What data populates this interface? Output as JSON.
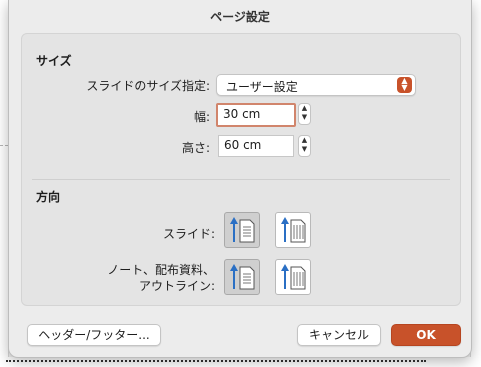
{
  "dialog": {
    "title": "ページ設定"
  },
  "size_section": {
    "heading": "サイズ",
    "slide_size_label": "スライドのサイズ指定:",
    "slide_size_value": "ユーザー設定",
    "width_label": "幅:",
    "width_value": "30 cm",
    "height_label": "高さ:",
    "height_value": "60 cm"
  },
  "orientation_section": {
    "heading": "方向",
    "slides_label": "スライド:",
    "notes_label_line1": "ノート、配布資料、",
    "notes_label_line2": "アウトライン:",
    "slides_selected": "portrait",
    "notes_selected": "portrait"
  },
  "buttons": {
    "header_footer": "ヘッダー/フッター...",
    "cancel": "キャンセル",
    "ok": "OK"
  },
  "colors": {
    "accent": "#c8522a",
    "focus_ring": "#d1856c",
    "arrow_blue": "#2a6fc4"
  }
}
